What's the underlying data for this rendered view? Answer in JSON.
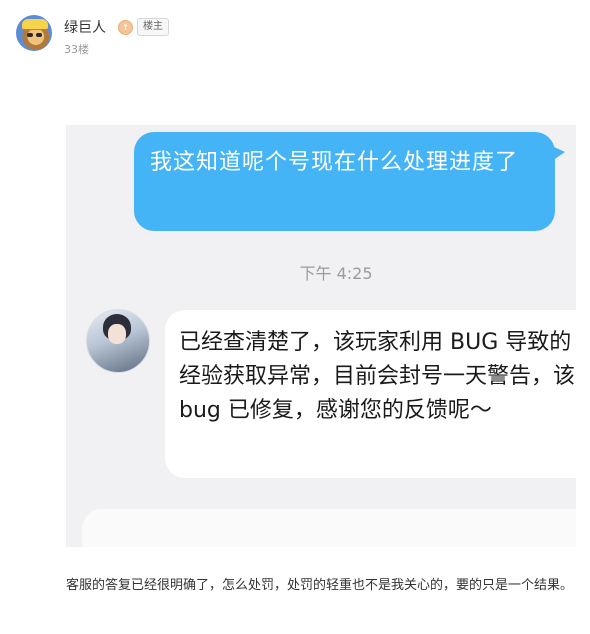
{
  "post": {
    "username": "绿巨人",
    "level_icon_text": "↑",
    "owner_tag": "楼主",
    "floor": "33楼",
    "avatar_icon": "clash-barbarian-avatar",
    "level_icon": "level-badge-icon"
  },
  "chat_image": {
    "sent_message": "我这知道呢个号现在什么处理进度了",
    "timestamp": "下午 4:25",
    "reply_message": "已经查清楚了，该玩家利用 BUG 导致的经验获取异常，目前会封号一天警告，该 bug 已修复，感谢您的反馈呢～",
    "sent_bubble_color": "#45b4f6",
    "background_color": "#f1f1f4"
  },
  "comment": {
    "text": "客服的答复已经很明确了，怎么处罚，处罚的轻重也不是我关心的，要的只是一个结果。"
  }
}
